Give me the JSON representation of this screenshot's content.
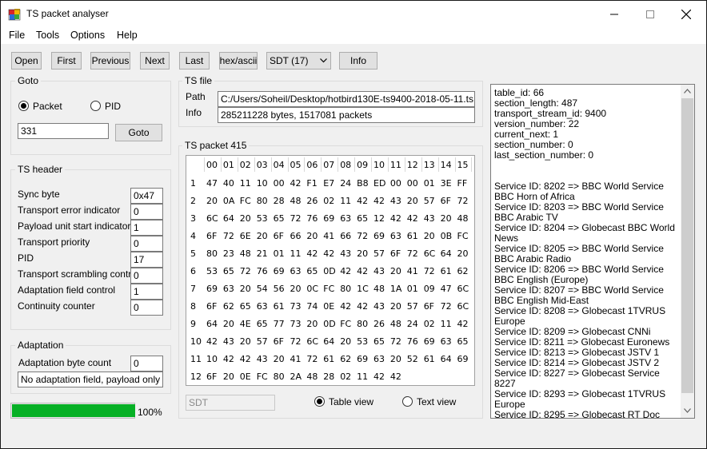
{
  "window": {
    "title": "TS packet analyser"
  },
  "menu": {
    "file": "File",
    "tools": "Tools",
    "options": "Options",
    "help": "Help"
  },
  "toolbar": {
    "open": "Open",
    "first": "First",
    "previous": "Previous",
    "next": "Next",
    "last": "Last",
    "hex_ascii": "hex/ascii",
    "table_select": "SDT (17)",
    "info": "Info"
  },
  "goto": {
    "title": "Goto",
    "packet_label": "Packet",
    "pid_label": "PID",
    "selected": "Packet",
    "value": "331",
    "button": "Goto"
  },
  "ts_header": {
    "title": "TS header",
    "fields": [
      {
        "label": "Sync byte",
        "value": "0x47"
      },
      {
        "label": "Transport error indicator",
        "value": "0"
      },
      {
        "label": "Payload unit start indicator",
        "value": "1"
      },
      {
        "label": "Transport priority",
        "value": "0"
      },
      {
        "label": "PID",
        "value": "17"
      },
      {
        "label": "Transport scrambling control",
        "value": "0"
      },
      {
        "label": "Adaptation field control",
        "value": "1"
      },
      {
        "label": "Continuity counter",
        "value": "0"
      }
    ]
  },
  "adaptation": {
    "title": "Adaptation",
    "byte_count_label": "Adaptation byte count",
    "byte_count": "0",
    "description": "No adaptation field, payload only"
  },
  "progress": {
    "value": 1.0,
    "label": "100%"
  },
  "ts_file": {
    "title": "TS file",
    "path_label": "Path",
    "path": "C:/Users/Soheil/Desktop/hotbird130E-ts9400-2018-05-11.ts",
    "info_label": "Info",
    "info": "285211228 bytes,  1517081 packets"
  },
  "ts_packet": {
    "title": "TS packet 415",
    "columns": [
      "00",
      "01",
      "02",
      "03",
      "04",
      "05",
      "06",
      "07",
      "08",
      "09",
      "10",
      "11",
      "12",
      "13",
      "14",
      "15"
    ],
    "rows": [
      {
        "n": "1",
        "bytes": [
          "47",
          "40",
          "11",
          "10",
          "00",
          "42",
          "F1",
          "E7",
          "24",
          "B8",
          "ED",
          "00",
          "00",
          "01",
          "3E",
          "FF"
        ]
      },
      {
        "n": "2",
        "bytes": [
          "20",
          "0A",
          "FC",
          "80",
          "28",
          "48",
          "26",
          "02",
          "11",
          "42",
          "42",
          "43",
          "20",
          "57",
          "6F",
          "72"
        ]
      },
      {
        "n": "3",
        "bytes": [
          "6C",
          "64",
          "20",
          "53",
          "65",
          "72",
          "76",
          "69",
          "63",
          "65",
          "12",
          "42",
          "42",
          "43",
          "20",
          "48"
        ]
      },
      {
        "n": "4",
        "bytes": [
          "6F",
          "72",
          "6E",
          "20",
          "6F",
          "66",
          "20",
          "41",
          "66",
          "72",
          "69",
          "63",
          "61",
          "20",
          "0B",
          "FC"
        ]
      },
      {
        "n": "5",
        "bytes": [
          "80",
          "23",
          "48",
          "21",
          "01",
          "11",
          "42",
          "42",
          "43",
          "20",
          "57",
          "6F",
          "72",
          "6C",
          "64",
          "20"
        ]
      },
      {
        "n": "6",
        "bytes": [
          "53",
          "65",
          "72",
          "76",
          "69",
          "63",
          "65",
          "0D",
          "42",
          "42",
          "43",
          "20",
          "41",
          "72",
          "61",
          "62"
        ]
      },
      {
        "n": "7",
        "bytes": [
          "69",
          "63",
          "20",
          "54",
          "56",
          "20",
          "0C",
          "FC",
          "80",
          "1C",
          "48",
          "1A",
          "01",
          "09",
          "47",
          "6C"
        ]
      },
      {
        "n": "8",
        "bytes": [
          "6F",
          "62",
          "65",
          "63",
          "61",
          "73",
          "74",
          "0E",
          "42",
          "42",
          "43",
          "20",
          "57",
          "6F",
          "72",
          "6C"
        ]
      },
      {
        "n": "9",
        "bytes": [
          "64",
          "20",
          "4E",
          "65",
          "77",
          "73",
          "20",
          "0D",
          "FC",
          "80",
          "26",
          "48",
          "24",
          "02",
          "11",
          "42"
        ]
      },
      {
        "n": "10",
        "bytes": [
          "42",
          "43",
          "20",
          "57",
          "6F",
          "72",
          "6C",
          "64",
          "20",
          "53",
          "65",
          "72",
          "76",
          "69",
          "63",
          "65"
        ]
      },
      {
        "n": "11",
        "bytes": [
          "10",
          "42",
          "42",
          "43",
          "20",
          "41",
          "72",
          "61",
          "62",
          "69",
          "63",
          "20",
          "52",
          "61",
          "64",
          "69"
        ]
      },
      {
        "n": "12",
        "bytes": [
          "6F",
          "20",
          "0E",
          "FC",
          "80",
          "2A",
          "48",
          "28",
          "02",
          "11",
          "42",
          "42"
        ]
      }
    ],
    "table_name": "SDT",
    "table_view_label": "Table view",
    "text_view_label": "Text view",
    "selected_view": "Table view"
  },
  "details": {
    "text": "table_id: 66\nsection_length: 487\ntransport_stream_id: 9400\nversion_number: 22\ncurrent_next: 1\nsection_number: 0\nlast_section_number: 0\n\n\nService ID: 8202 => BBC World Service BBC Horn of Africa\nService ID: 8203 => BBC World Service BBC Arabic TV\nService ID: 8204 => Globecast BBC World News\nService ID: 8205 => BBC World Service BBC Arabic Radio\nService ID: 8206 => BBC World Service BBC English (Europe)\nService ID: 8207 => BBC World Service BBC English Mid-East\nService ID: 8208 => Globecast 1TVRUS Europe\nService ID: 8209 => Globecast CNNi\nService ID: 8211 => Globecast Euronews\nService ID: 8213 => Globecast JSTV 1\nService ID: 8214 => Globecast JSTV 2\nService ID: 8227 => Globecast Service 8227\nService ID: 8293 => Globecast 1TVRUS Europe\nService ID: 8295 => Globecast RT Doc"
  }
}
